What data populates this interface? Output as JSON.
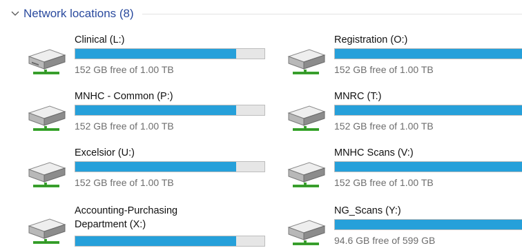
{
  "group": {
    "title": "Network locations (8)"
  },
  "drives": [
    {
      "name": "Clinical (L:)",
      "free": "152 GB free of 1.00 TB",
      "used_fraction": 0.852,
      "icon": "network-drive-icon"
    },
    {
      "name": "Registration (O:)",
      "free": "152 GB free of 1.00 TB",
      "used_fraction": 0.852,
      "icon": "network-drive-icon"
    },
    {
      "name": "MNHC - Common (P:)",
      "free": "152 GB free of 1.00 TB",
      "used_fraction": 0.852,
      "icon": "network-drive-icon"
    },
    {
      "name": "MNRC (T:)",
      "free": "152 GB free of 1.00 TB",
      "used_fraction": 0.852,
      "icon": "network-drive-icon"
    },
    {
      "name": "Excelsior (U:)",
      "free": "152 GB free of 1.00 TB",
      "used_fraction": 0.852,
      "icon": "network-drive-icon"
    },
    {
      "name": "MNHC Scans (V:)",
      "free": "152 GB free of 1.00 TB",
      "used_fraction": 0.852,
      "icon": "network-drive-icon"
    },
    {
      "name": "Accounting-Purchasing Department (X:)",
      "free": "",
      "used_fraction": 0.852,
      "icon": "network-drive-icon"
    },
    {
      "name": "NG_Scans (Y:)",
      "free": "94.6 GB free of 599 GB",
      "used_fraction": 0.842,
      "icon": "network-drive-icon"
    }
  ],
  "colors": {
    "bar_fill": "#26a0da",
    "bar_track": "#e6e6e6",
    "title": "#2a4a9e"
  }
}
